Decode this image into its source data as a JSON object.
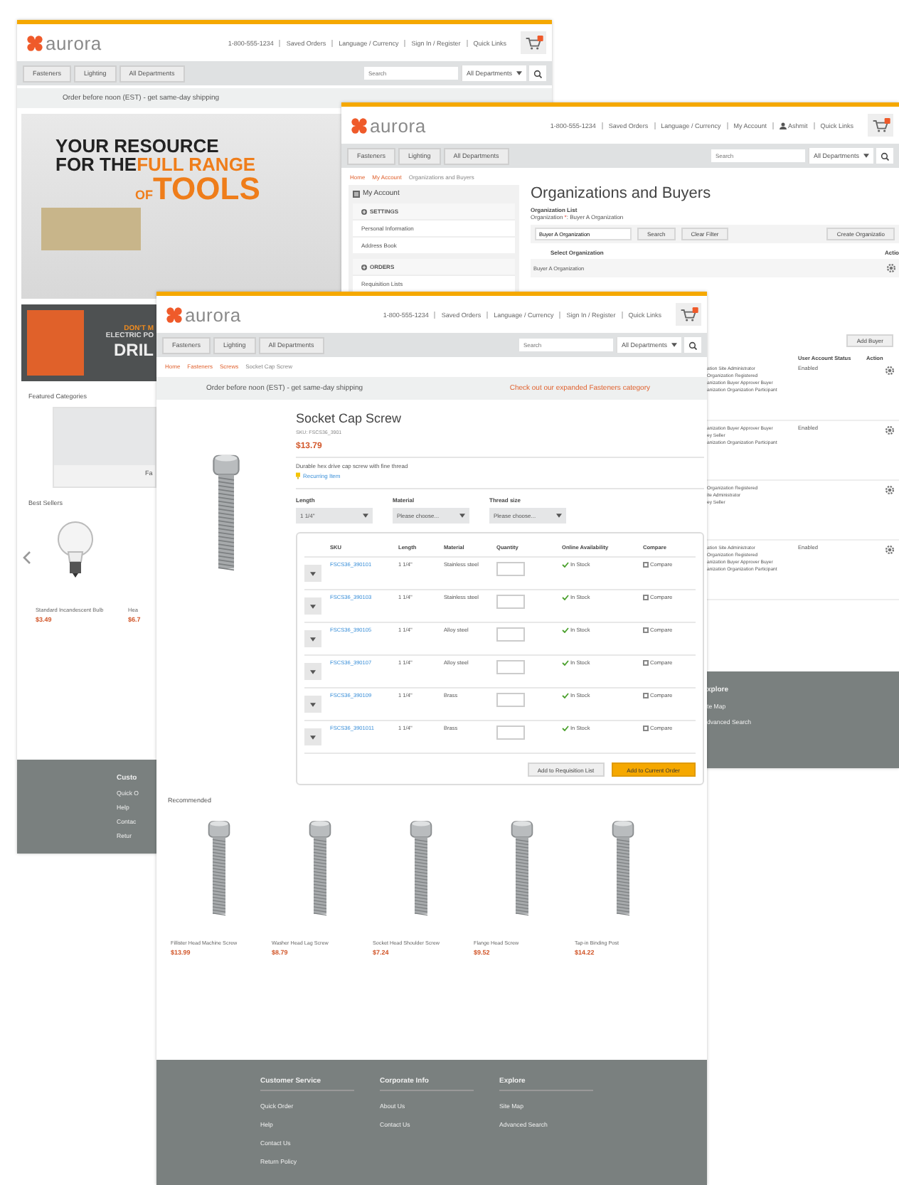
{
  "home_window": {
    "header": {
      "logo": "aurora",
      "links": [
        "1-800-555-1234",
        "Saved Orders",
        "Language / Currency",
        "Sign In / Register",
        "Quick Links"
      ]
    },
    "nav": {
      "departments": [
        "Fasteners",
        "Lighting",
        "All Departments"
      ],
      "search": {
        "placeholder": "Search"
      },
      "category_select": "All Departments"
    },
    "promo": "Order before noon (EST) - get same-day shipping",
    "hero": {
      "lines": [
        [
          {
            "kind": "dark",
            "text": "YOUR RESOURCE"
          }
        ],
        [
          {
            "kind": "dark",
            "text": "FOR THE "
          },
          {
            "kind": "accent",
            "text": "FULL RANGE"
          }
        ],
        [
          {
            "kind": "accent_small",
            "text": "OF "
          },
          {
            "kind": "accent_large",
            "text": "TOOLS"
          }
        ]
      ]
    },
    "banner": {
      "lines": [
        "DON'T M",
        "ELECTRIC PO",
        "DRIL"
      ]
    },
    "featured": {
      "title": "Featured Categories",
      "card_label": "Fa"
    },
    "best_sellers": {
      "title": "Best Sellers",
      "products": [
        {
          "name": "Standard Incandescent Bulb",
          "price": "$3.49"
        },
        {
          "name": "Hea",
          "price": "$6.7"
        }
      ]
    },
    "footer": {
      "heading": "Custo",
      "links": [
        "Quick O",
        "Help",
        "Contac",
        "Retur"
      ]
    }
  },
  "account_window": {
    "header": {
      "logo": "aurora",
      "links": [
        "1-800-555-1234",
        "Saved Orders",
        "Language / Currency",
        "My Account",
        "Quick Links"
      ],
      "user": "Ashmit"
    },
    "nav": {
      "departments": [
        "Fasteners",
        "Lighting",
        "All Departments"
      ],
      "search": {
        "placeholder": "Search"
      },
      "category_select": "All Departments"
    },
    "breadcrumb": [
      "Home",
      "My Account",
      "Organizations and Buyers"
    ],
    "sidebar": {
      "title": "My Account",
      "sections": [
        {
          "title": "SETTINGS",
          "items": [
            "Personal Information",
            "Address Book"
          ]
        },
        {
          "title": "ORDERS",
          "items": [
            "Requisition Lists"
          ]
        }
      ]
    },
    "title": "Organizations and Buyers",
    "org_list": {
      "label": "Organization List",
      "filter_label": "Organization ",
      "required_mark": "*",
      "filter_value": ": Buyer A Organization"
    },
    "filter": {
      "value": "Buyer A Organization",
      "buttons": [
        "Search",
        "Clear Filter"
      ],
      "create_button": "Create Organizatio"
    },
    "org_table": {
      "columns": [
        "Select Organization",
        "Actio"
      ],
      "rows": [
        {
          "name": "Buyer A Organization"
        }
      ]
    },
    "buyers": {
      "add_button": "Add Buyer",
      "columns": [
        "User Account Status",
        "Action"
      ],
      "rows": [
        {
          "roles": [
            "ation Site Administrator",
            "Organization Registered",
            "anization Buyer Approver Buyer",
            "anization Organization Participant"
          ],
          "status": "Enabled"
        },
        {
          "roles": [
            "anization Buyer Approver Buyer",
            "ey Seller",
            "anization Organization Participant"
          ],
          "status": "Enabled"
        },
        {
          "roles": [
            "Organization Registered",
            "ite Administrator",
            "ey Seller"
          ]
        },
        {
          "roles": [
            "ation Site Administrator",
            "Organization Registered",
            "anization Buyer Approver Buyer",
            "anization Organization Participant"
          ],
          "status": "Enabled"
        }
      ]
    },
    "footer": {
      "heading": "xplore",
      "links": [
        "te Map",
        "dvanced Search"
      ]
    }
  },
  "product_window": {
    "header": {
      "logo": "aurora",
      "links": [
        "1-800-555-1234",
        "Saved Orders",
        "Language / Currency",
        "Sign In / Register",
        "Quick Links"
      ]
    },
    "nav": {
      "departments": [
        "Fasteners",
        "Lighting",
        "All Departments"
      ],
      "search": {
        "placeholder": "Search"
      },
      "category_select": "All Departments"
    },
    "breadcrumb": [
      "Home",
      "Fasteners",
      "Screws",
      "Socket Cap Screw"
    ],
    "promo": {
      "text": "Order before noon (EST) - get same-day shipping",
      "link": "Check out our expanded Fasteners category"
    },
    "product": {
      "title": "Socket Cap Screw",
      "sku": "SKU: FSCS36_3901",
      "price": "$13.79",
      "description": "Durable hex drive cap screw with fine thread",
      "recurring": "Recurring Item",
      "attributes": [
        {
          "label": "Length",
          "value": "1 1/4\""
        },
        {
          "label": "Material",
          "value": "Please choose..."
        },
        {
          "label": "Thread size",
          "value": "Please choose..."
        }
      ]
    },
    "sku_table": {
      "columns": [
        "SKU",
        "Length",
        "Material",
        "Quantity",
        "Online Availability",
        "Compare"
      ],
      "rows": [
        {
          "sku": "FSCS36_390101",
          "length": "1 1/4\"",
          "material": "Stainless steel",
          "availability": "In Stock",
          "compare": "Compare",
          "checked": false
        },
        {
          "sku": "FSCS36_390103",
          "length": "1 1/4\"",
          "material": "Stainless steel",
          "availability": "In Stock",
          "compare": "Compare",
          "checked": false
        },
        {
          "sku": "FSCS36_390105",
          "length": "1 1/4\"",
          "material": "Alloy steel",
          "availability": "In Stock",
          "compare": "Compare",
          "checked": false
        },
        {
          "sku": "FSCS36_390107",
          "length": "1 1/4\"",
          "material": "Alloy steel",
          "availability": "In Stock",
          "compare": "Compare",
          "checked": false
        },
        {
          "sku": "FSCS36_390109",
          "length": "1 1/4\"",
          "material": "Brass",
          "availability": "In Stock",
          "compare": "Compare",
          "checked": false
        },
        {
          "sku": "FSCS36_3901011",
          "length": "1 1/4\"",
          "material": "Brass",
          "availability": "In Stock",
          "compare": "Compare",
          "checked": false
        }
      ]
    },
    "buttons": [
      "Add to Requisition List",
      "Add to Current Order"
    ],
    "recommended": {
      "title": "Recommended",
      "products": [
        {
          "name": "Fillister Head Machine Screw",
          "price": "$13.99"
        },
        {
          "name": "Washer Head Lag Screw",
          "price": "$8.79"
        },
        {
          "name": "Socket Head Shoulder Screw",
          "price": "$7.24"
        },
        {
          "name": "Flange Head Screw",
          "price": "$9.52"
        },
        {
          "name": "Tap-in Binding Post",
          "price": "$14.22"
        }
      ]
    },
    "footer": {
      "columns": [
        {
          "heading": "Customer Service",
          "links": [
            "Quick Order",
            "Help",
            "Contact Us",
            "Return Policy"
          ]
        },
        {
          "heading": "Corporate Info",
          "links": [
            "About Us",
            "Contact Us"
          ]
        },
        {
          "heading": "Explore",
          "links": [
            "Site Map",
            "Advanced Search"
          ]
        }
      ]
    }
  }
}
